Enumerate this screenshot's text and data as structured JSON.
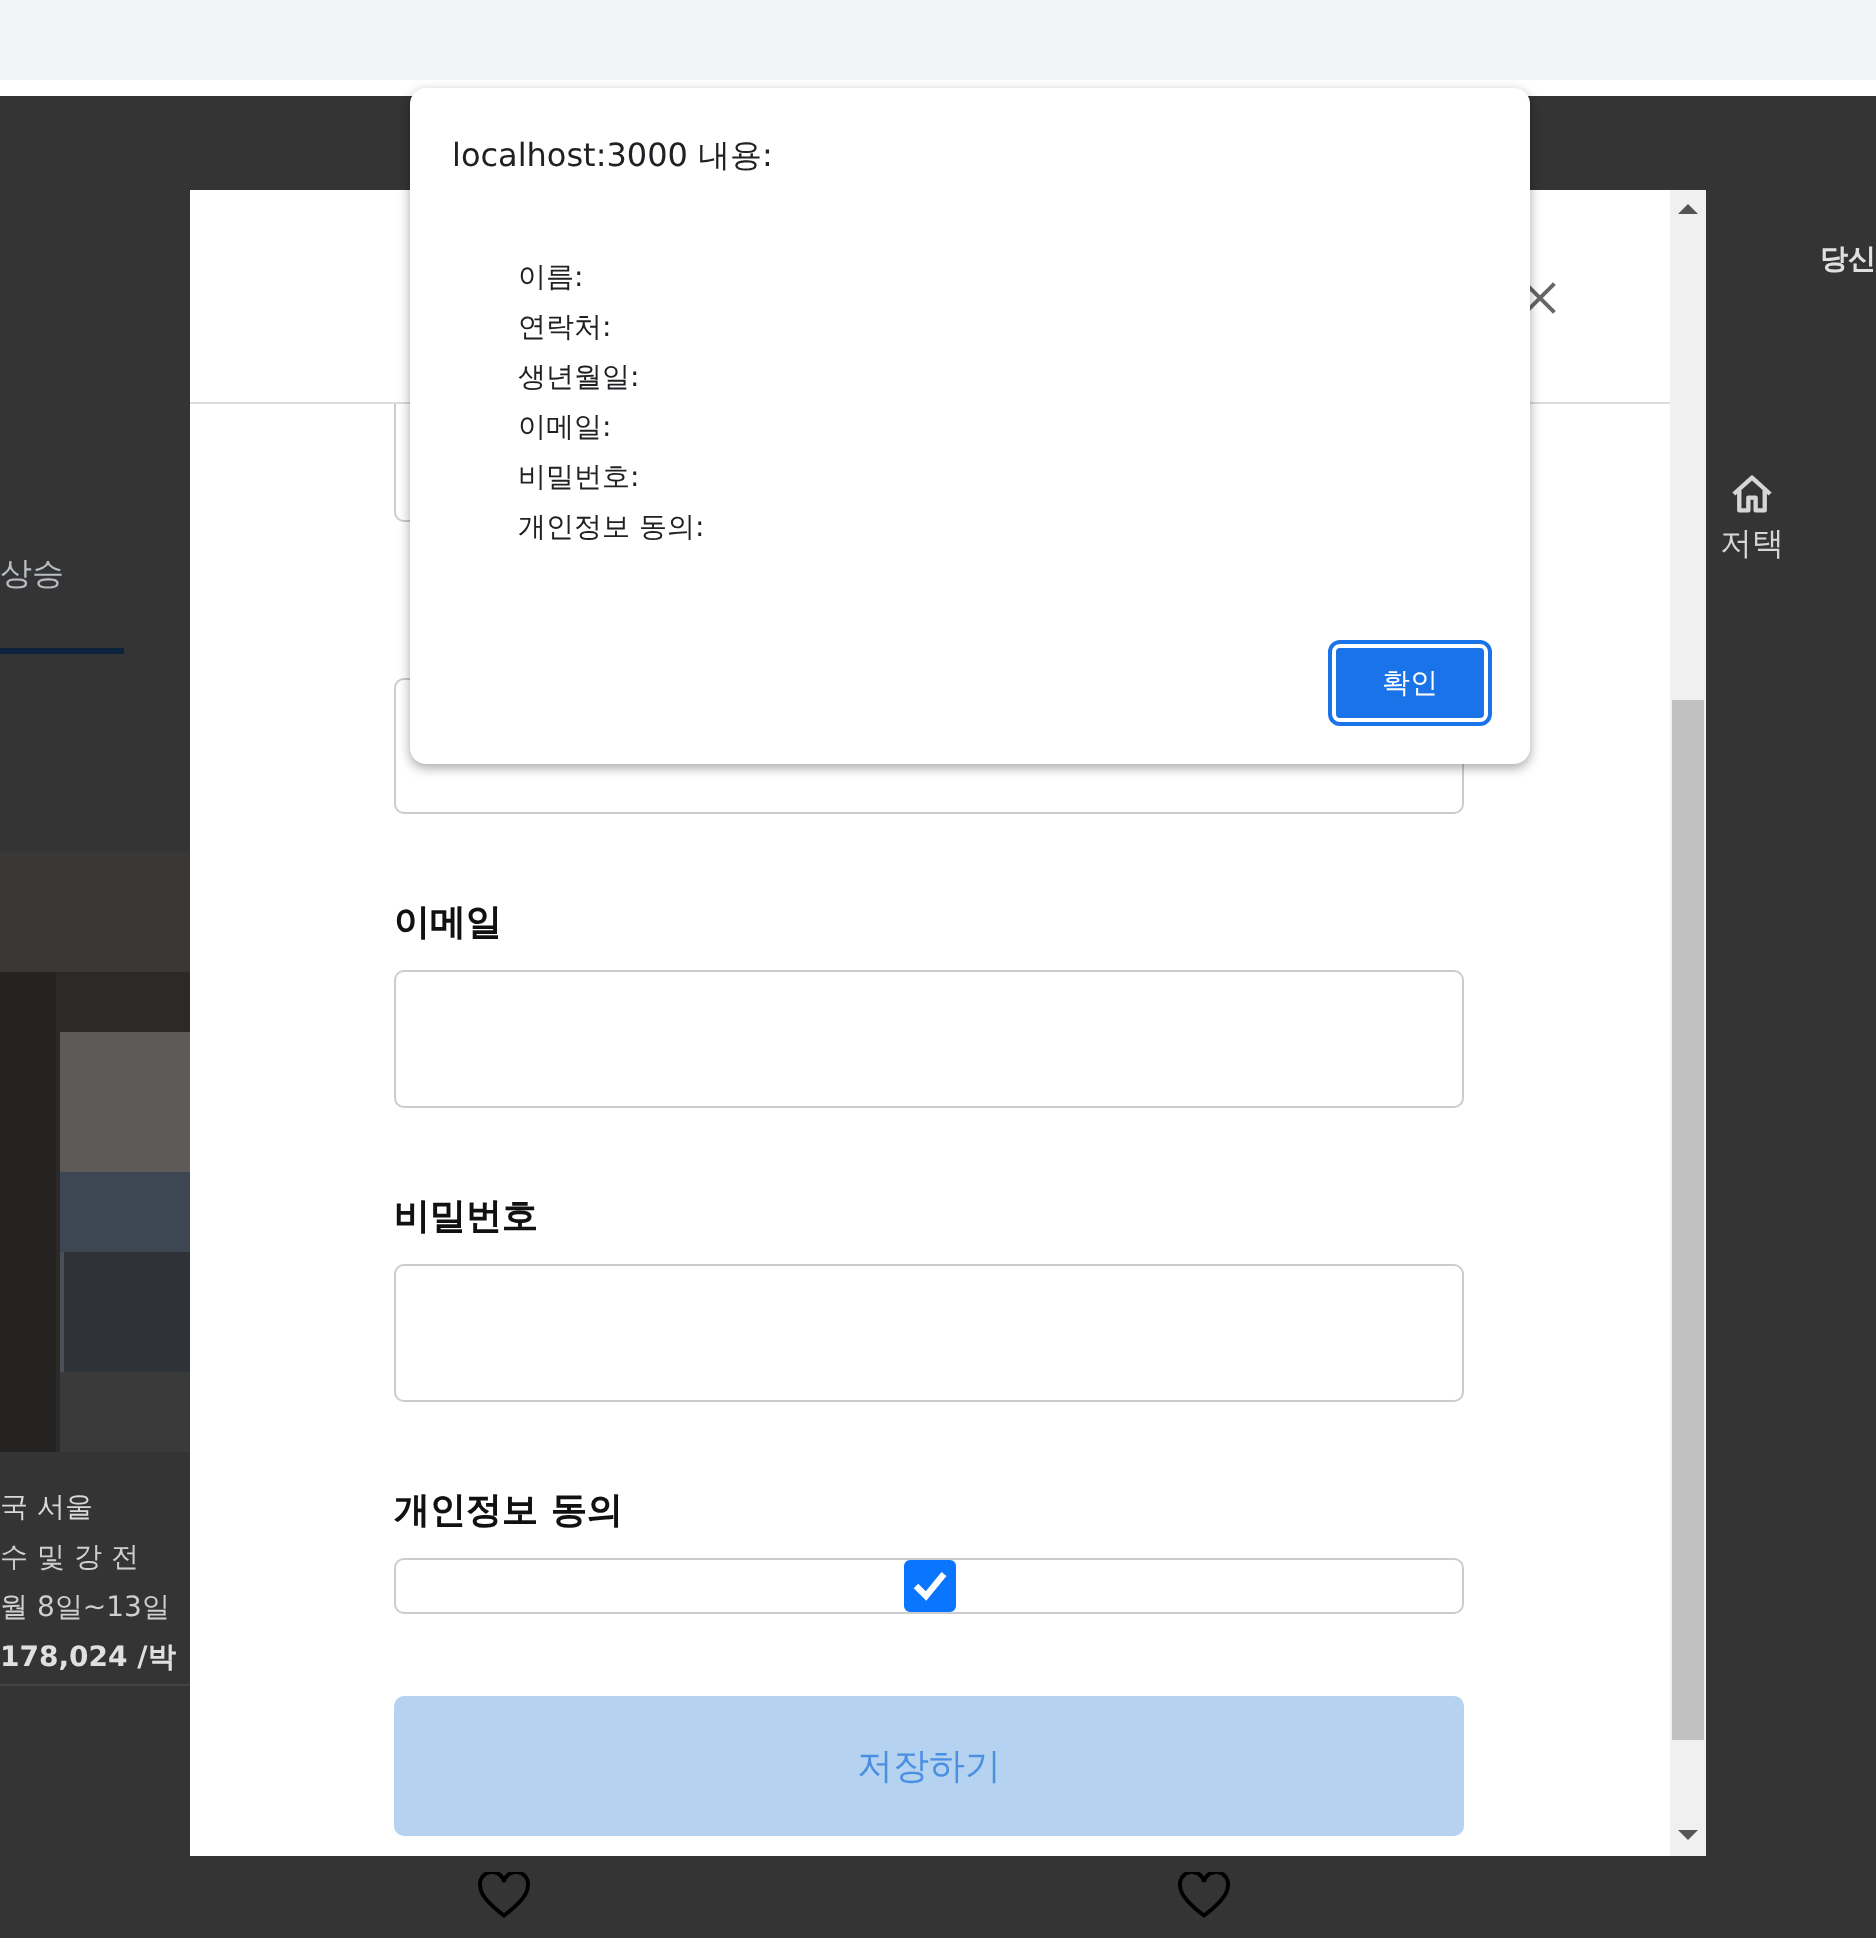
{
  "background": {
    "header_text": "당신",
    "tab": {
      "label": "상승",
      "selected": true
    },
    "nav_item": {
      "label": "저택"
    },
    "listing": {
      "lines": [
        "국 서울",
        "수 및 강 전",
        "월 8일~13일",
        "178,024 /박"
      ]
    }
  },
  "modal": {
    "fields": [
      {
        "label": "이메일",
        "kind": "text"
      },
      {
        "label": "비밀번호",
        "kind": "text"
      },
      {
        "label": "개인정보 동의",
        "kind": "checkbox",
        "checked": true
      }
    ],
    "submit": {
      "label": "저장하기",
      "disabled": true
    }
  },
  "dialog": {
    "title": "localhost:3000 내용:",
    "lines": [
      "이름:",
      "연락처:",
      "생년월일:",
      "이메일:",
      "비밀번호:",
      "개인정보 동의:"
    ],
    "button": "확인"
  }
}
